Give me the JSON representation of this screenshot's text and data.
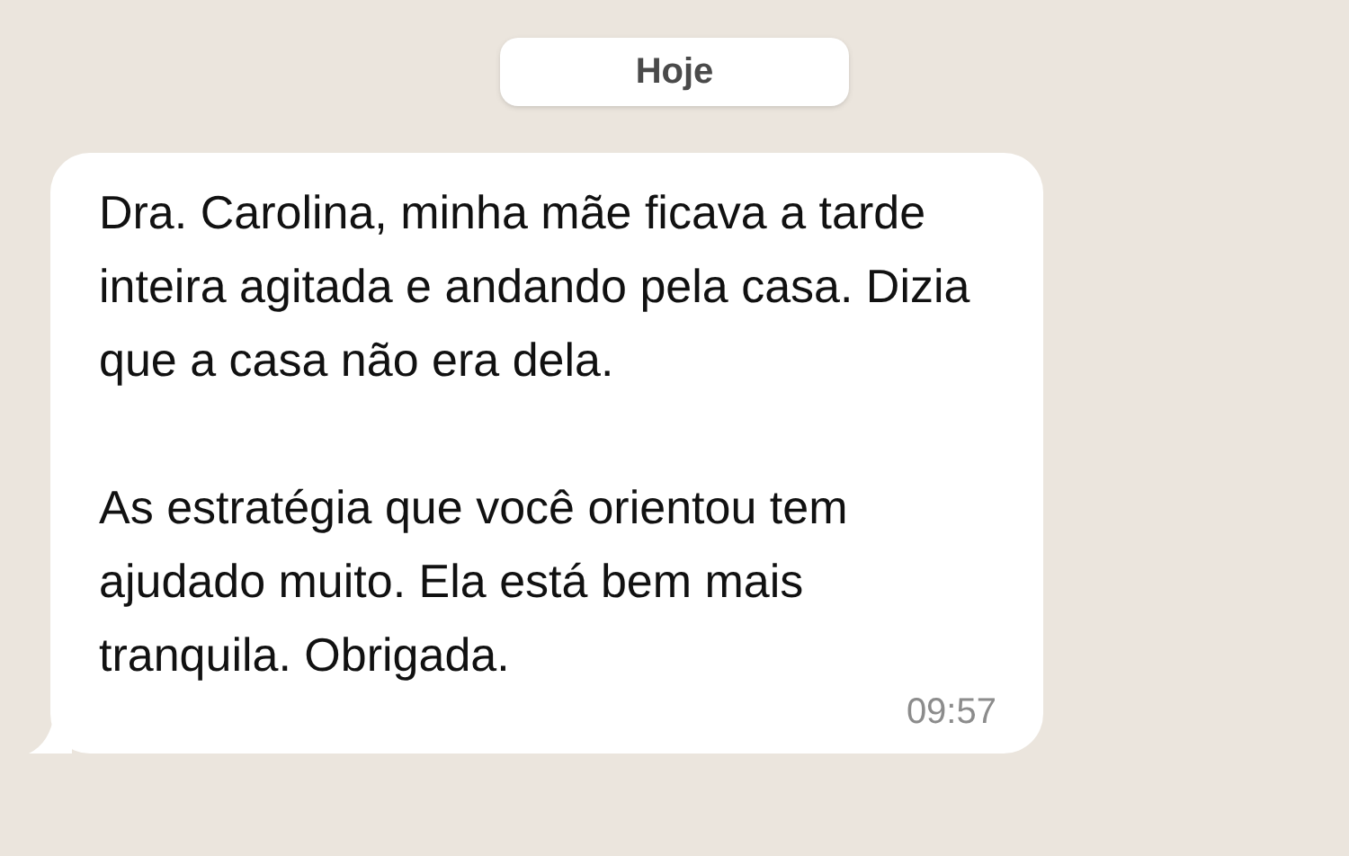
{
  "date_divider": {
    "label": "Hoje"
  },
  "message": {
    "paragraphs": [
      "Dra. Carolina, minha mãe ficava a tarde inteira agitada e andando pela casa. Dizia que a casa não era dela.",
      "As estratégia que você orientou tem ajudado muito. Ela está bem mais tranquila. Obrigada."
    ],
    "time": "09:57"
  }
}
